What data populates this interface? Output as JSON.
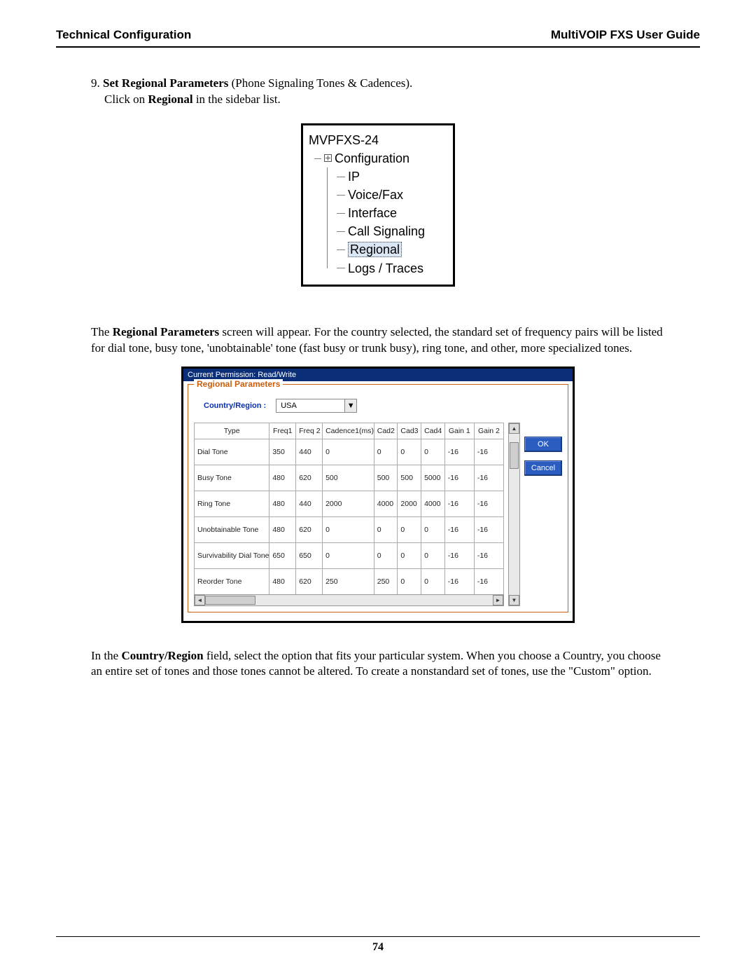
{
  "header": {
    "left": "Technical Configuration",
    "right": "MultiVOIP FXS User Guide"
  },
  "step": {
    "num": "9.",
    "bold1": "Set Regional Parameters",
    "rest1": "  (Phone Signaling Tones & Cadences).",
    "line2a": "Click on ",
    "bold2": "Regional",
    "line2b": " in the sidebar list."
  },
  "tree": {
    "root": "MVPFXS-24",
    "branch": "Configuration",
    "leaves": [
      "IP",
      "Voice/Fax",
      "Interface",
      "Call Signaling",
      "Regional",
      "Logs / Traces"
    ],
    "highlighted_index": 4
  },
  "para1": {
    "pre": "The ",
    "bold": "Regional Parameters",
    "post": " screen will appear. For the country selected, the standard set of frequency pairs will be listed for dial tone, busy tone, 'unobtainable' tone (fast busy or trunk busy), ring tone, and other, more specialized tones."
  },
  "screenshot": {
    "permission": "Current Permission: Read/Write",
    "group_title": "Regional Parameters",
    "country_label": "Country/Region :",
    "country_value": "USA",
    "ok": "OK",
    "cancel": "Cancel",
    "columns": [
      "Type",
      "Freq1",
      "Freq 2",
      "Cadence1(ms)",
      "Cad2",
      "Cad3",
      "Cad4",
      "Gain 1",
      "Gain 2"
    ],
    "rows": [
      {
        "type": "Dial Tone",
        "f1": "350",
        "f2": "440",
        "c1": "0",
        "c2": "0",
        "c3": "0",
        "c4": "0",
        "g1": "-16",
        "g2": "-16"
      },
      {
        "type": "Busy Tone",
        "f1": "480",
        "f2": "620",
        "c1": "500",
        "c2": "500",
        "c3": "500",
        "c4": "5000",
        "g1": "-16",
        "g2": "-16"
      },
      {
        "type": "Ring Tone",
        "f1": "480",
        "f2": "440",
        "c1": "2000",
        "c2": "4000",
        "c3": "2000",
        "c4": "4000",
        "g1": "-16",
        "g2": "-16"
      },
      {
        "type": "Unobtainable Tone",
        "f1": "480",
        "f2": "620",
        "c1": "0",
        "c2": "0",
        "c3": "0",
        "c4": "0",
        "g1": "-16",
        "g2": "-16"
      },
      {
        "type": "Survivability Dial Tone",
        "f1": "650",
        "f2": "650",
        "c1": "0",
        "c2": "0",
        "c3": "0",
        "c4": "0",
        "g1": "-16",
        "g2": "-16"
      },
      {
        "type": "Reorder Tone",
        "f1": "480",
        "f2": "620",
        "c1": "250",
        "c2": "250",
        "c3": "0",
        "c4": "0",
        "g1": "-16",
        "g2": "-16"
      }
    ]
  },
  "para2": {
    "pre": "In the ",
    "bold": "Country/Region",
    "post": " field, select the option that fits your particular system.  When you choose a Country, you choose an entire set of tones and those tones cannot be altered.  To create a nonstandard set of tones, use the \"Custom\" option."
  },
  "page_number": "74"
}
